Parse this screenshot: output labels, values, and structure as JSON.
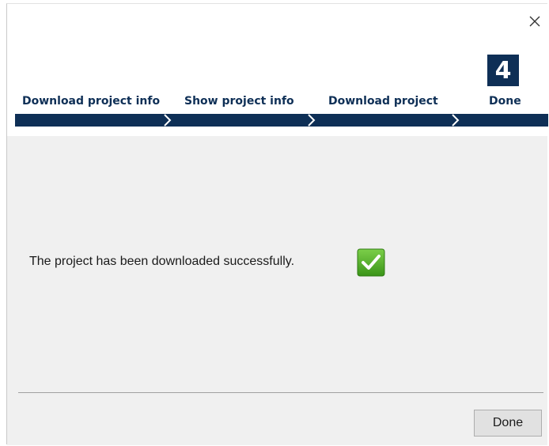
{
  "wizard": {
    "current_step_number": "4",
    "steps": [
      {
        "label": "Download project info"
      },
      {
        "label": "Show project info"
      },
      {
        "label": "Download project"
      },
      {
        "label": "Done"
      }
    ]
  },
  "content": {
    "message": "The project has been downloaded successfully.",
    "status_icon": "success-check-icon"
  },
  "footer": {
    "done_label": "Done"
  },
  "colors": {
    "accent": "#0e2f56",
    "success": "#3f9a1f",
    "panel_bg": "#f0f0f0"
  }
}
